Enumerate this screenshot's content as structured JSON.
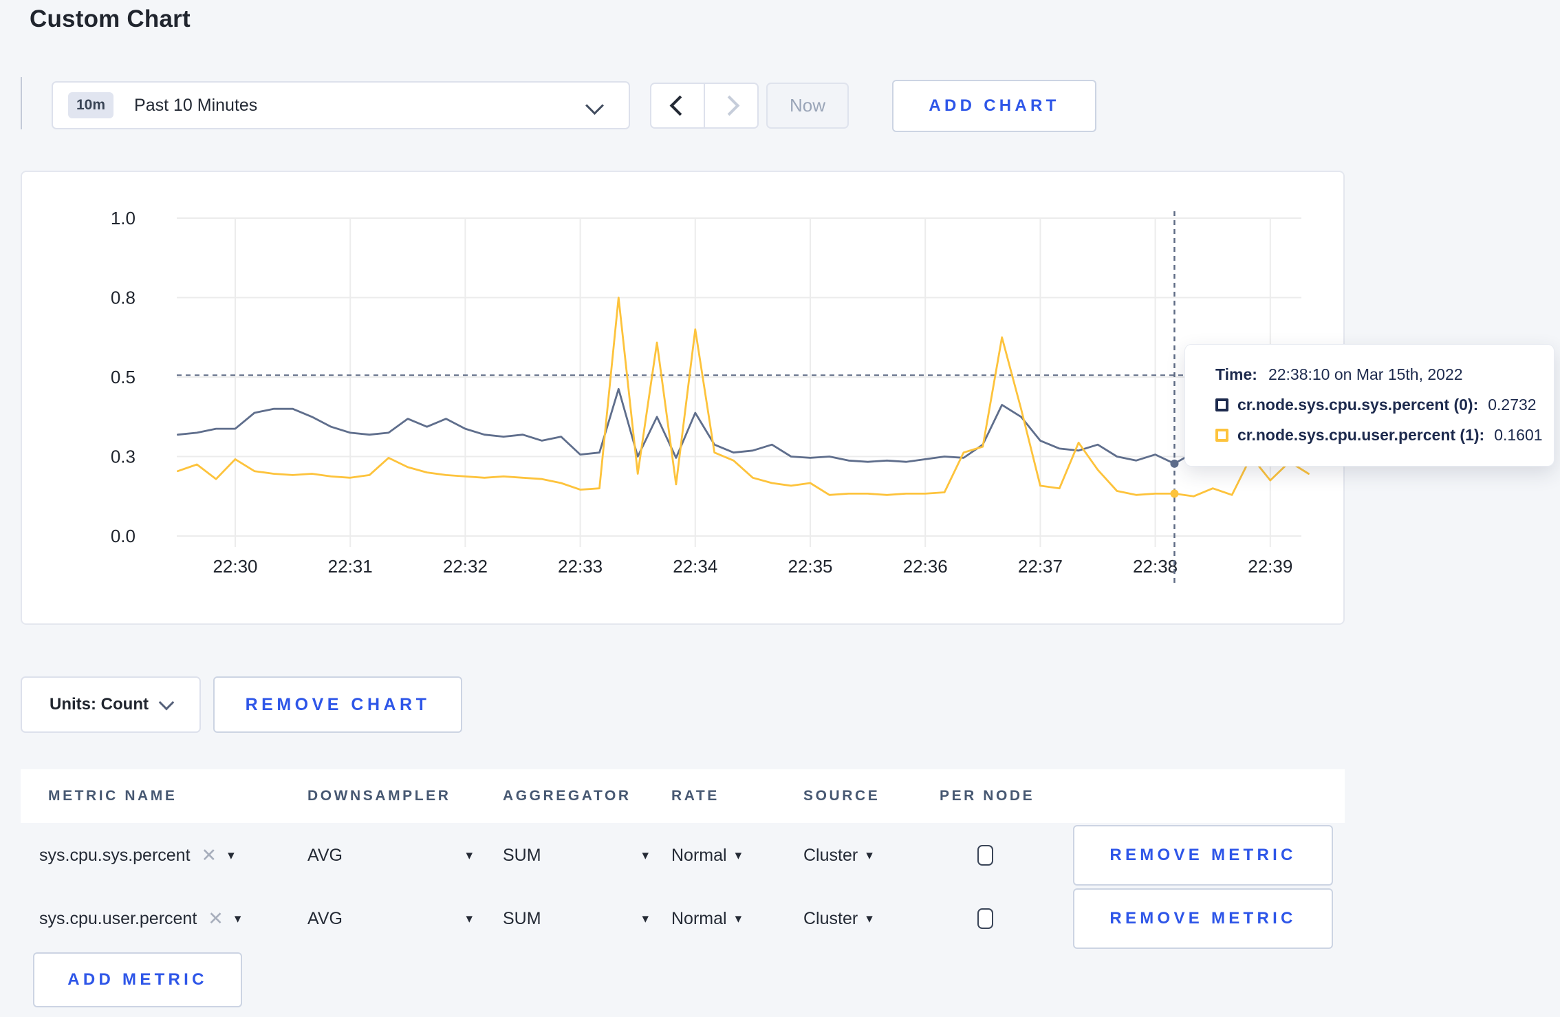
{
  "page": {
    "title": "Custom Chart"
  },
  "colors": {
    "accent_blue": "#2e56e8",
    "series_sys": "#5f6e8c",
    "series_user": "#fdc33c",
    "navy": "#1d2a4d",
    "grid": "#ececec",
    "crosshair": "#5f6c85",
    "page_bg": "#f4f6f9"
  },
  "icons": {
    "caret_down": "▾",
    "close": "✕"
  },
  "toolbar": {
    "range_badge": "10m",
    "range_label": "Past 10 Minutes",
    "now_label": "Now",
    "add_chart_label": "ADD CHART"
  },
  "chart_controls": {
    "units_label": "Units: Count",
    "remove_chart_label": "REMOVE CHART"
  },
  "tooltip": {
    "time_label": "Time:",
    "time_value": "22:38:10 on Mar 15th, 2022",
    "rows": [
      {
        "name": "cr.node.sys.cpu.sys.percent (0):",
        "value": "0.2732",
        "color": "#1d2a4d"
      },
      {
        "name": "cr.node.sys.cpu.user.percent (1):",
        "value": "0.1601",
        "color": "#fdc33c"
      }
    ]
  },
  "chart_data": {
    "type": "line",
    "title": "",
    "xlabel": "",
    "ylabel": "",
    "x_start": "22:29:30",
    "x_step_seconds": 10,
    "x_tick_labels": [
      "22:30",
      "22:31",
      "22:32",
      "22:33",
      "22:34",
      "22:35",
      "22:36",
      "22:37",
      "22:38",
      "22:39"
    ],
    "y_ticks": [
      0.0,
      0.3,
      0.5,
      0.8,
      1.0
    ],
    "y_tick_labels": [
      "0.0",
      "0.3",
      "0.5",
      "0.8",
      "1.0"
    ],
    "grid": true,
    "legend_position": "tooltip",
    "crosshair": {
      "time": "22:38:10",
      "x_minutes_after_2200": 38.1667,
      "h_line_value": 0.507
    },
    "series": [
      {
        "name": "cr.node.sys.cpu.sys.percent (0)",
        "color": "#5f6e8c",
        "highlight_value": 0.2732,
        "values": [
          0.355,
          0.36,
          0.37,
          0.37,
          0.41,
          0.42,
          0.42,
          0.4,
          0.375,
          0.36,
          0.355,
          0.36,
          0.395,
          0.375,
          0.395,
          0.37,
          0.355,
          0.35,
          0.355,
          0.34,
          0.35,
          0.305,
          0.31,
          0.47,
          0.3,
          0.4,
          0.295,
          0.41,
          0.33,
          0.31,
          0.315,
          0.33,
          0.3,
          0.295,
          0.3,
          0.285,
          0.28,
          0.285,
          0.28,
          0.29,
          0.3,
          0.295,
          0.33,
          0.43,
          0.4,
          0.34,
          0.32,
          0.315,
          0.33,
          0.3,
          0.285,
          0.305,
          0.2732,
          0.31,
          0.3,
          0.295,
          0.3,
          0.31,
          0.3,
          0.3
        ]
      },
      {
        "name": "cr.node.sys.cpu.user.percent (1)",
        "color": "#fdc33c",
        "highlight_value": 0.1601,
        "values": [
          0.245,
          0.27,
          0.215,
          0.29,
          0.245,
          0.235,
          0.23,
          0.235,
          0.225,
          0.22,
          0.23,
          0.295,
          0.26,
          0.24,
          0.23,
          0.225,
          0.22,
          0.225,
          0.22,
          0.215,
          0.2,
          0.175,
          0.18,
          0.8,
          0.235,
          0.63,
          0.195,
          0.68,
          0.31,
          0.285,
          0.22,
          0.2,
          0.19,
          0.2,
          0.155,
          0.16,
          0.16,
          0.155,
          0.16,
          0.16,
          0.165,
          0.31,
          0.325,
          0.65,
          0.42,
          0.19,
          0.18,
          0.335,
          0.25,
          0.17,
          0.155,
          0.16,
          0.1601,
          0.15,
          0.18,
          0.155,
          0.3,
          0.21,
          0.28,
          0.235
        ]
      }
    ]
  },
  "metrics_table": {
    "headers": [
      "METRIC NAME",
      "DOWNSAMPLER",
      "AGGREGATOR",
      "RATE",
      "SOURCE",
      "PER NODE"
    ],
    "rows": [
      {
        "name": "sys.cpu.sys.percent",
        "downsampler": "AVG",
        "aggregator": "SUM",
        "rate": "Normal",
        "source": "Cluster",
        "per_node_checked": false,
        "remove_label": "REMOVE METRIC"
      },
      {
        "name": "sys.cpu.user.percent",
        "downsampler": "AVG",
        "aggregator": "SUM",
        "rate": "Normal",
        "source": "Cluster",
        "per_node_checked": false,
        "remove_label": "REMOVE METRIC"
      }
    ],
    "add_metric_label": "ADD METRIC"
  }
}
